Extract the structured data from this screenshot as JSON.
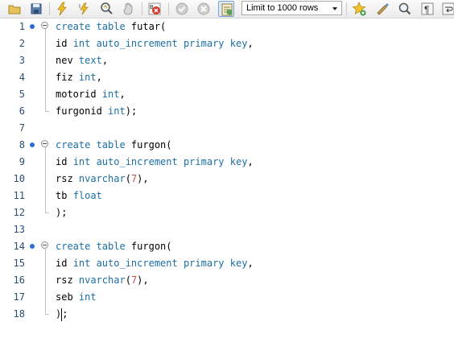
{
  "toolbar": {
    "limit_select": "Limit to 1000 rows",
    "icons": [
      "open-folder-icon",
      "save-icon",
      "execute-icon",
      "execute-current-icon",
      "explain-icon",
      "stop-icon",
      "toggle-error-icon",
      "commit-icon",
      "rollback-icon",
      "autocommit-icon",
      "add-snippet-icon",
      "beautify-icon",
      "find-icon",
      "invisible-chars-icon",
      "word-wrap-icon"
    ]
  },
  "editor": {
    "line_numbers": [
      "1",
      "2",
      "3",
      "4",
      "5",
      "6",
      "7",
      "8",
      "9",
      "10",
      "11",
      "12",
      "13",
      "14",
      "15",
      "16",
      "17",
      "18"
    ],
    "lines": [
      [
        [
          "kw",
          "create table"
        ],
        [
          "t",
          " futar("
        ]
      ],
      [
        [
          "t",
          "id "
        ],
        [
          "kw",
          "int auto_increment primary key"
        ],
        [
          "t",
          ","
        ]
      ],
      [
        [
          "t",
          "nev "
        ],
        [
          "kw",
          "text"
        ],
        [
          "t",
          ","
        ]
      ],
      [
        [
          "t",
          "fiz "
        ],
        [
          "kw",
          "int"
        ],
        [
          "t",
          ","
        ]
      ],
      [
        [
          "t",
          "motorid "
        ],
        [
          "kw",
          "int"
        ],
        [
          "t",
          ","
        ]
      ],
      [
        [
          "t",
          "furgonid "
        ],
        [
          "kw",
          "int"
        ],
        [
          "t",
          ");"
        ]
      ],
      [],
      [
        [
          "kw",
          "create table"
        ],
        [
          "t",
          " furgon("
        ]
      ],
      [
        [
          "t",
          "id "
        ],
        [
          "kw",
          "int auto_increment primary key"
        ],
        [
          "t",
          ","
        ]
      ],
      [
        [
          "t",
          "rsz "
        ],
        [
          "kw",
          "nvarchar"
        ],
        [
          "t",
          "("
        ],
        [
          "num",
          "7"
        ],
        [
          "t",
          "),"
        ]
      ],
      [
        [
          "t",
          "tb "
        ],
        [
          "kw",
          "float"
        ]
      ],
      [
        [
          "t",
          ");"
        ]
      ],
      [],
      [
        [
          "kw",
          "create table"
        ],
        [
          "t",
          " furgon("
        ]
      ],
      [
        [
          "t",
          "id "
        ],
        [
          "kw",
          "int auto_increment primary key"
        ],
        [
          "t",
          ","
        ]
      ],
      [
        [
          "t",
          "rsz "
        ],
        [
          "kw",
          "nvarchar"
        ],
        [
          "t",
          "("
        ],
        [
          "num",
          "7"
        ],
        [
          "t",
          "),"
        ]
      ],
      [
        [
          "t",
          "seb "
        ],
        [
          "kw",
          "int"
        ]
      ],
      [
        [
          "t",
          ");"
        ]
      ]
    ],
    "statement_starts": [
      1,
      8,
      14
    ],
    "statement_ends": [
      6,
      12,
      18
    ],
    "cursor_line": 18
  }
}
